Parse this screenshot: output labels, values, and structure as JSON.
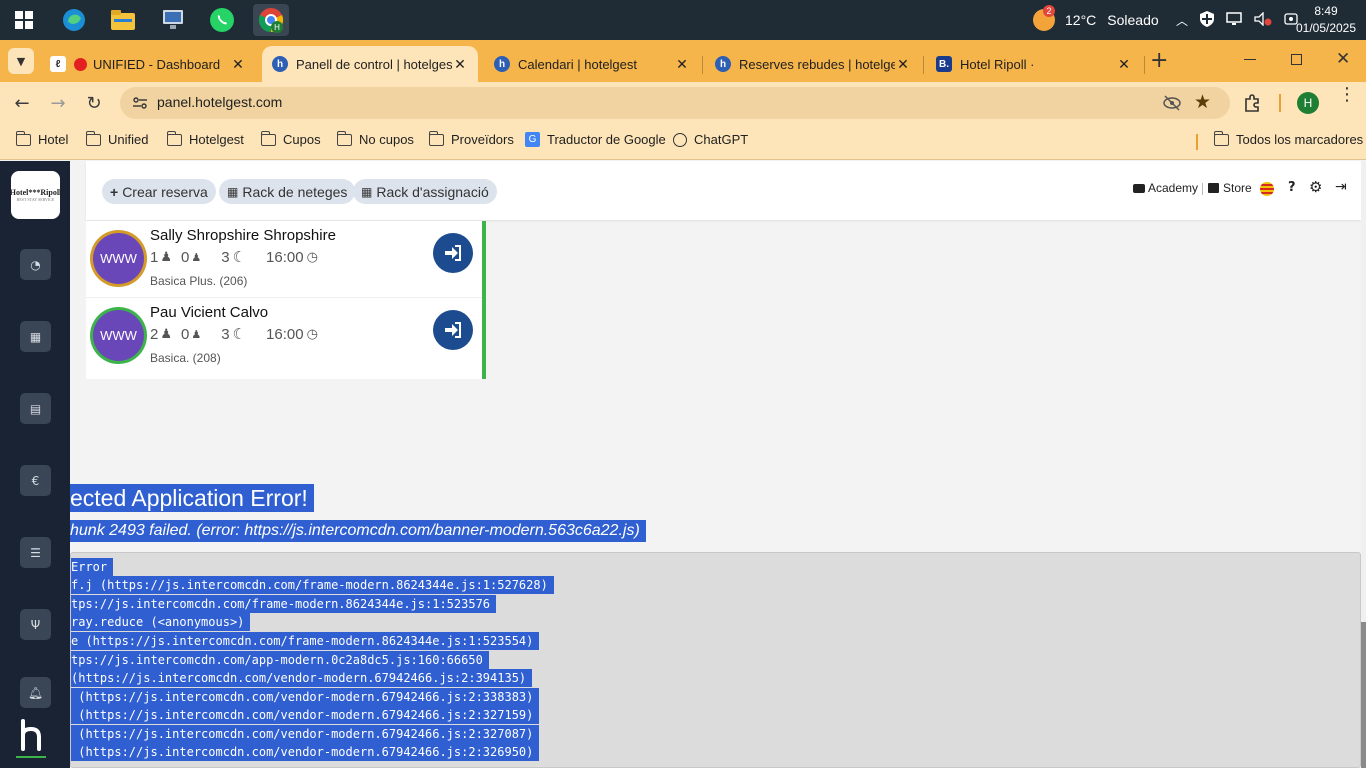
{
  "taskbar": {
    "weather_temp": "12°C",
    "weather_desc": "Soleado",
    "weather_badge": "2",
    "time": "8:49",
    "date": "01/05/2025"
  },
  "tabs": [
    {
      "title": "UNIFIED - Dashboard"
    },
    {
      "title": "Panell de control | hotelgest"
    },
    {
      "title": "Calendari | hotelgest"
    },
    {
      "title": "Reserves rebudes | hotelgest"
    },
    {
      "title": "Hotel Ripoll ·"
    }
  ],
  "address": {
    "url": "panel.hotelgest.com"
  },
  "profile_initial": "H",
  "bookmarks": {
    "items": [
      "Hotel",
      "Unified",
      "Hotelgest",
      "Cupos",
      "No cupos",
      "Proveïdors",
      "Traductor de Google",
      "ChatGPT"
    ],
    "all": "Todos los marcadores"
  },
  "sidebar": {
    "logo_line1": "Hotel***Ripoll",
    "logo_line2": "BEST STAY SERVICE"
  },
  "header": {
    "create": "Crear reserva",
    "rack_cleaning": "Rack de neteges",
    "rack_assign": "Rack d'assignació",
    "academy": "Academy",
    "store": "Store"
  },
  "bookings": [
    {
      "avatar": "WWW",
      "name": "Sally Shropshire Shropshire",
      "adults": "1",
      "children": "0",
      "nights": "3",
      "time": "16:00",
      "room": "Basica Plus. (206)",
      "ring": "#d49a2a"
    },
    {
      "avatar": "WWW",
      "name": "Pau Vicient Calvo",
      "adults": "2",
      "children": "0",
      "nights": "3",
      "time": "16:00",
      "room": "Basica. (208)",
      "ring": "#3cb44b"
    }
  ],
  "error": {
    "title": "ected Application Error!",
    "subtitle": "hunk 2493 failed. (error: https://js.intercomcdn.com/banner-modern.563c6a22.js)",
    "stack": [
      "Error",
      "f.j (https://js.intercomcdn.com/frame-modern.8624344e.js:1:527628)",
      "tps://js.intercomcdn.com/frame-modern.8624344e.js:1:523576",
      "ray.reduce (<anonymous>)",
      "e (https://js.intercomcdn.com/frame-modern.8624344e.js:1:523554)",
      "tps://js.intercomcdn.com/app-modern.0c2a8dc5.js:160:66650",
      "(https://js.intercomcdn.com/vendor-modern.67942466.js:2:394135)",
      " (https://js.intercomcdn.com/vendor-modern.67942466.js:2:338383)",
      " (https://js.intercomcdn.com/vendor-modern.67942466.js:2:327159)",
      " (https://js.intercomcdn.com/vendor-modern.67942466.js:2:327087)",
      " (https://js.intercomcdn.com/vendor-modern.67942466.js:2:326950)"
    ]
  }
}
